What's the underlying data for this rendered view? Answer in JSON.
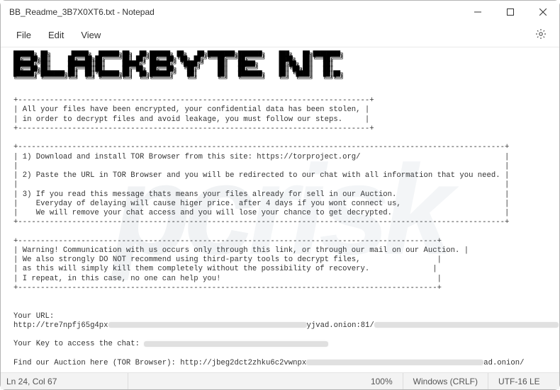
{
  "window": {
    "title": "BB_Readme_3B7X0XT6.txt - Notepad"
  },
  "menu": {
    "file": "File",
    "edit": "Edit",
    "view": "View"
  },
  "note": {
    "box1_l1": "| All your files have been encrypted, your confidential data has been stolen, |",
    "box1_l2": "| in order to decrypt files and avoid leakage, you must follow our steps.     |",
    "box1_sep": "+------------------------------------------------------------------------------+",
    "box2_sep": "+------------------------------------------------------------------------------------------------------------+",
    "box2_l1": "| 1) Download and install TOR Browser from this site: https://torproject.org/                                |",
    "box2_l2": "|                                                                                                            |",
    "box2_l3": "| 2) Paste the URL in TOR Browser and you will be redirected to our chat with all information that you need. |",
    "box2_l4": "|                                                                                                            |",
    "box2_l5": "| 3) If you read this message thats means your files already for sell in our Auction.                        |",
    "box2_l6": "|    Everyday of delaying will cause higer price. after 4 days if you wont connect us,                       |",
    "box2_l7": "|    We will remove your chat access and you will lose your chance to get decrypted.                         |",
    "box3_sep": "+---------------------------------------------------------------------------------------------+",
    "box3_l1": "| Warning! Communication with us occurs only through this link, or through our mail on our Auction. |",
    "box3_l2": "| We also strongly DO NOT recommend using third-party tools to decrypt files,                 |",
    "box3_l3": "| as this will simply kill them completely without the possibility of recovery.              |",
    "box3_l4": "| I repeat, in this case, no one can help you!                                                |",
    "url_label": "Your URL:",
    "url_pre": "http://tre7npfj65g4px",
    "url_post": "yjvad.onion:81/",
    "key_label": "Your Key to access the chat: ",
    "auction_pre": "Find our Auction here (TOR Browser): http://jbeg2dct2zhku6c2vwnpx",
    "auction_post": "ad.onion/"
  },
  "status": {
    "pos": "Ln 24, Col 67",
    "zoom": "100%",
    "eol": "Windows (CRLF)",
    "enc": "UTF-16 LE"
  }
}
